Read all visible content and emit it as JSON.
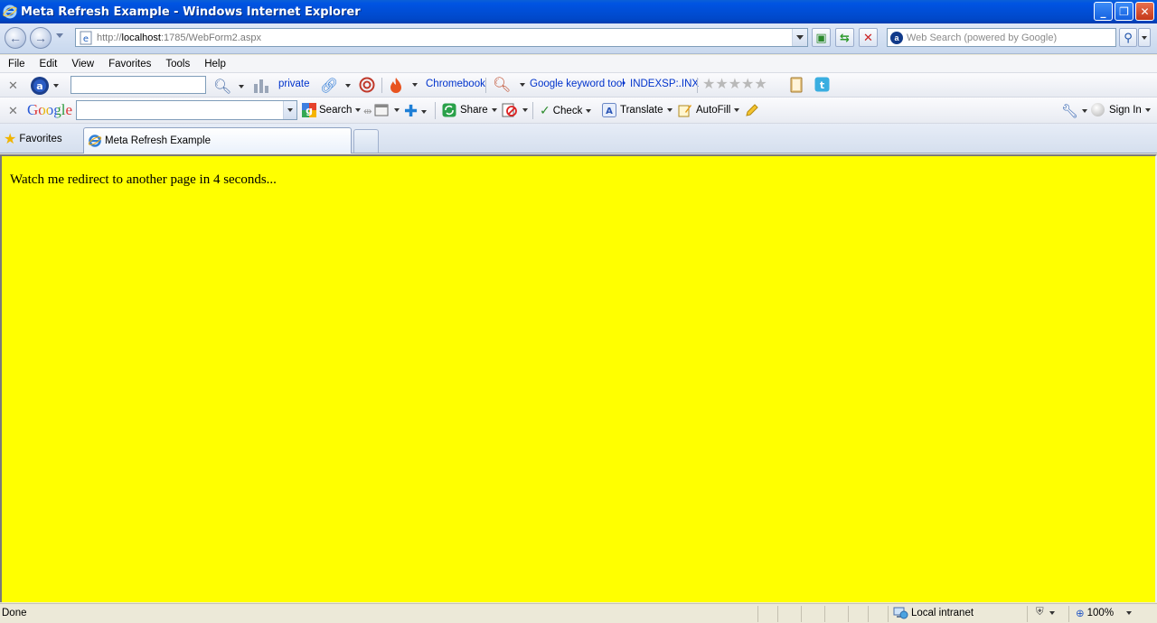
{
  "window": {
    "title": "Meta Refresh Example - Windows Internet Explorer",
    "buttons": {
      "minimize": "_",
      "maximize": "❐",
      "close": "✕"
    }
  },
  "address_bar": {
    "url_prefix": "http://",
    "url_host": "localhost",
    "url_rest": ":1785/WebForm2.aspx"
  },
  "search_box": {
    "placeholder": "Web Search (powered by Google)"
  },
  "menu": {
    "items": [
      "File",
      "Edit",
      "View",
      "Favorites",
      "Tools",
      "Help"
    ]
  },
  "toolbar1": {
    "private_label": "private",
    "chromebook_label": "Chromebook",
    "keyword_tool_label": "Google keyword tool",
    "bullet": "•",
    "indexsp_label": "INDEXSP:.INX"
  },
  "google_toolbar": {
    "logo": "Google",
    "search_label": "Search",
    "share_label": "Share",
    "check_label": "Check",
    "translate_label": "Translate",
    "autofill_label": "AutoFill",
    "signin_label": "Sign In"
  },
  "tabs": {
    "favorites_label": "Favorites",
    "active_tab_title": "Meta Refresh Example"
  },
  "page": {
    "background": "#ffff00",
    "message": "Watch me redirect to another page in 4 seconds..."
  },
  "status_bar": {
    "status": "Done",
    "zone": "Local intranet",
    "zoom": "100%"
  }
}
